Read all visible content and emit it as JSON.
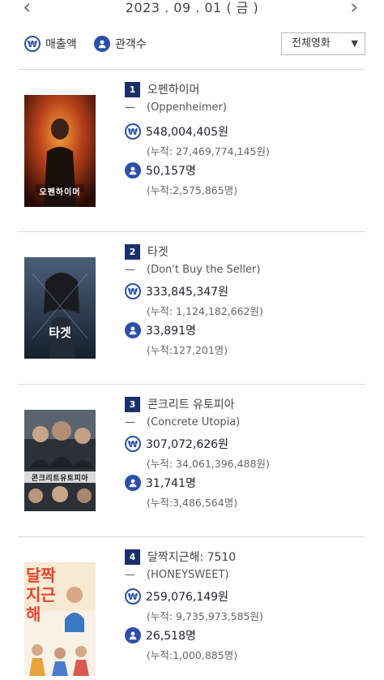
{
  "nav": {
    "prev_glyph": "‹",
    "next_glyph": "›",
    "date": "2023 . 09 . 01 ( 금 )"
  },
  "filters": {
    "sales_label": "매출액",
    "audience_label": "관객수",
    "sales_icon_glyph": "₩",
    "select_value": "전체영화",
    "select_caret": "▼"
  },
  "colors": {
    "accent": "#2d4fa8",
    "rank_bg": "#1c2f6b",
    "divider": "#d9d9d9"
  },
  "movies": [
    {
      "rank": "1",
      "title": "오펜하이머",
      "dash": "—",
      "original_title": "(Oppenheimer)",
      "sales": "548,004,405원",
      "sales_cumulative": "(누적: 27,469,774,145원)",
      "audience": "50,157명",
      "audience_cumulative": "(누적:2,575,865명)",
      "poster_text": "오펜하이머"
    },
    {
      "rank": "2",
      "title": "타겟",
      "dash": "—",
      "original_title": "(Don't Buy the Seller)",
      "sales": "333,845,347원",
      "sales_cumulative": "(누적: 1,124,182,662원)",
      "audience": "33,891명",
      "audience_cumulative": "(누적:127,201명)",
      "poster_text": "타겟"
    },
    {
      "rank": "3",
      "title": "콘크리트 유토피아",
      "dash": "—",
      "original_title": "(Concrete Utopia)",
      "sales": "307,072,626원",
      "sales_cumulative": "(누적: 34,061,396,488원)",
      "audience": "31,741명",
      "audience_cumulative": "(누적:3,486,564명)",
      "poster_text": "콘크리트유토피아"
    },
    {
      "rank": "4",
      "title": "달짝지근해: 7510",
      "dash": "—",
      "original_title": "(HONEYSWEET)",
      "sales": "259,076,149원",
      "sales_cumulative": "(누적: 9,735,973,585원)",
      "audience": "26,518명",
      "audience_cumulative": "(누적:1,000,885명)",
      "poster_text": "달짝지근해"
    }
  ]
}
